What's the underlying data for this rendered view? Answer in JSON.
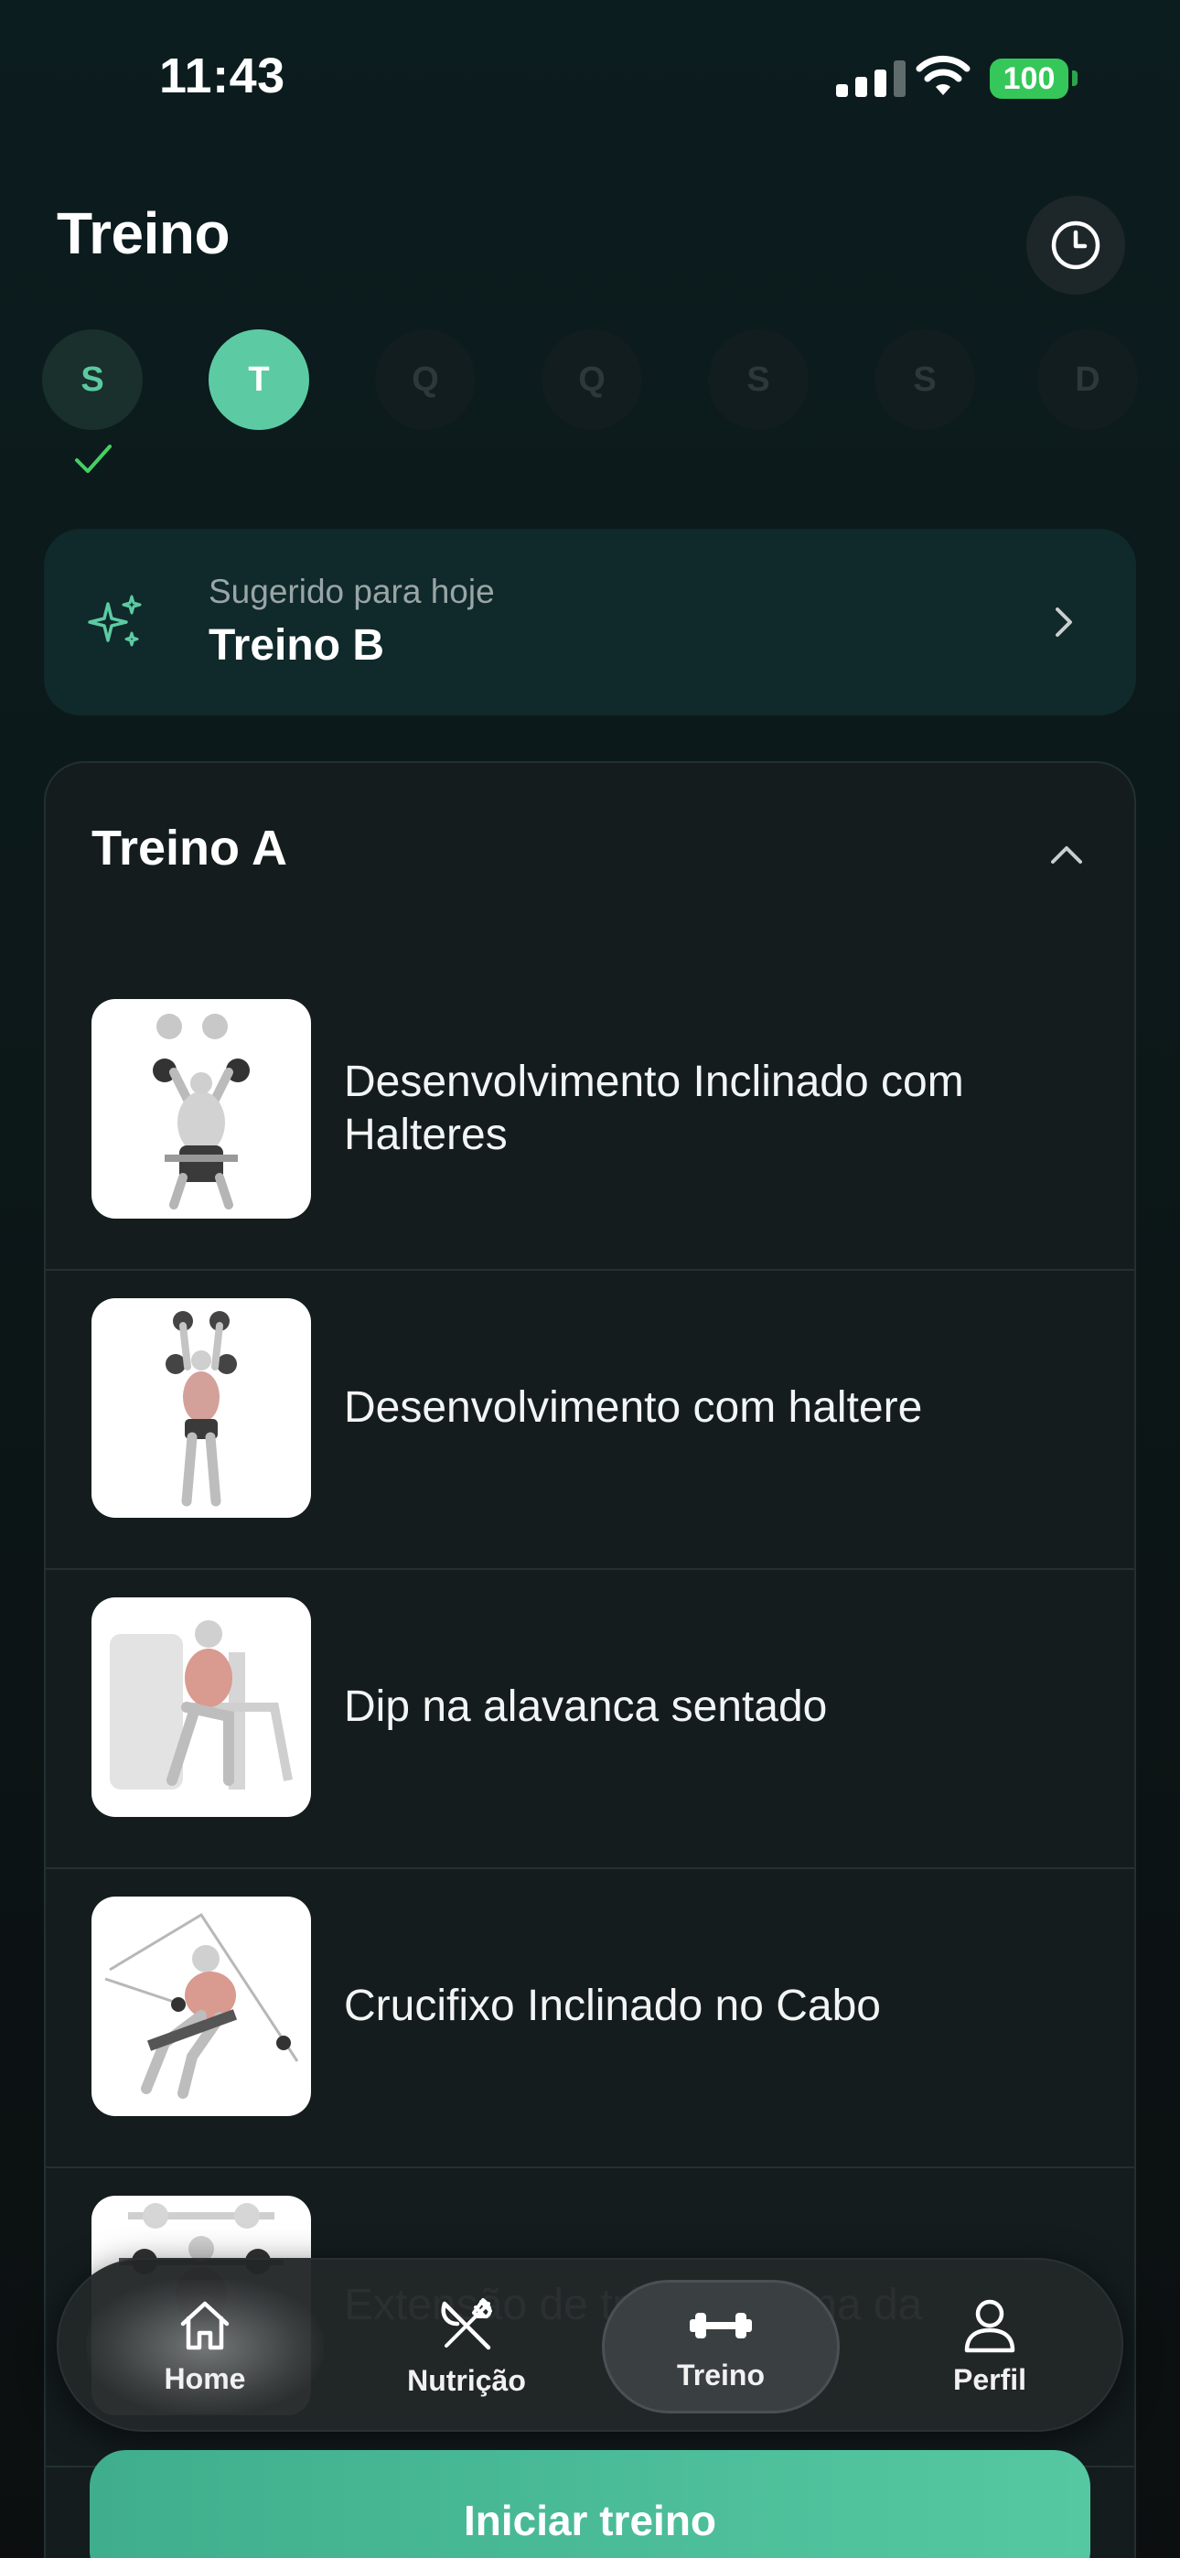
{
  "status_bar": {
    "time": "11:43",
    "battery": "100"
  },
  "header": {
    "title": "Treino"
  },
  "week": [
    {
      "letter": "S",
      "state": "done"
    },
    {
      "letter": "T",
      "state": "active"
    },
    {
      "letter": "Q",
      "state": "upcoming"
    },
    {
      "letter": "Q",
      "state": "upcoming"
    },
    {
      "letter": "S",
      "state": "upcoming"
    },
    {
      "letter": "S",
      "state": "upcoming"
    },
    {
      "letter": "D",
      "state": "upcoming"
    }
  ],
  "suggestion": {
    "subtitle": "Sugerido para hoje",
    "title": "Treino B"
  },
  "workout": {
    "title": "Treino A",
    "exercises": [
      {
        "name": "Desenvolvimento Inclinado com Halteres"
      },
      {
        "name": "Desenvolvimento com haltere"
      },
      {
        "name": "Dip na alavanca sentado"
      },
      {
        "name": "Crucifixo Inclinado no Cabo"
      },
      {
        "name": "Extensão de tríceps acima da"
      }
    ]
  },
  "tabbar": {
    "items": [
      {
        "label": "Home",
        "icon": "home-icon"
      },
      {
        "label": "Nutrição",
        "icon": "fork-knife-icon"
      },
      {
        "label": "Treino",
        "icon": "dumbbell-icon",
        "selected": true
      },
      {
        "label": "Perfil",
        "icon": "person-icon"
      }
    ]
  },
  "cta": {
    "label": "Iniciar treino"
  },
  "colors": {
    "accent": "#5ccba4",
    "background": "#0c1718",
    "card": "#141c1e"
  }
}
